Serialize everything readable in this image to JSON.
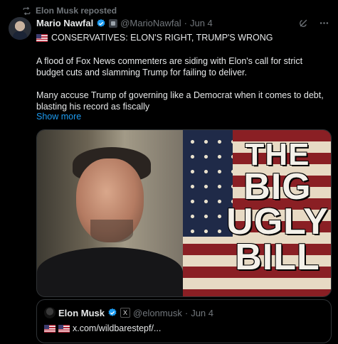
{
  "repost": {
    "label": "Elon Musk reposted",
    "icon": "repost-icon"
  },
  "author": {
    "name": "Mario Nawfal",
    "handle": "@MarioNawfal",
    "dot": "·",
    "date": "Jun 4"
  },
  "headline": {
    "flag_icon": "us-flag-icon",
    "text": "CONSERVATIVES: ELON'S RIGHT, TRUMP'S WRONG"
  },
  "body": {
    "p1": "A flood of Fox News commenters are siding with Elon's call for strict budget cuts and slamming Trump for failing to deliver.",
    "p2": "Many accuse Trump of governing like a Democrat when it comes to debt, blasting his record as fiscally"
  },
  "show_more": "Show more",
  "media": {
    "title_line1": "THE",
    "title_line2": "BIG",
    "title_line3": "UGLY",
    "title_line4": "BILL"
  },
  "quote": {
    "name": "Elon Musk",
    "handle": "@elonmusk",
    "dot": "·",
    "date": "Jun 4",
    "badge": "X",
    "link": "x.com/wildbarestepf/..."
  },
  "colors": {
    "background": "#000000",
    "link": "#1d9bf0",
    "verified": "#1d9bf0",
    "muted": "#71767b"
  }
}
